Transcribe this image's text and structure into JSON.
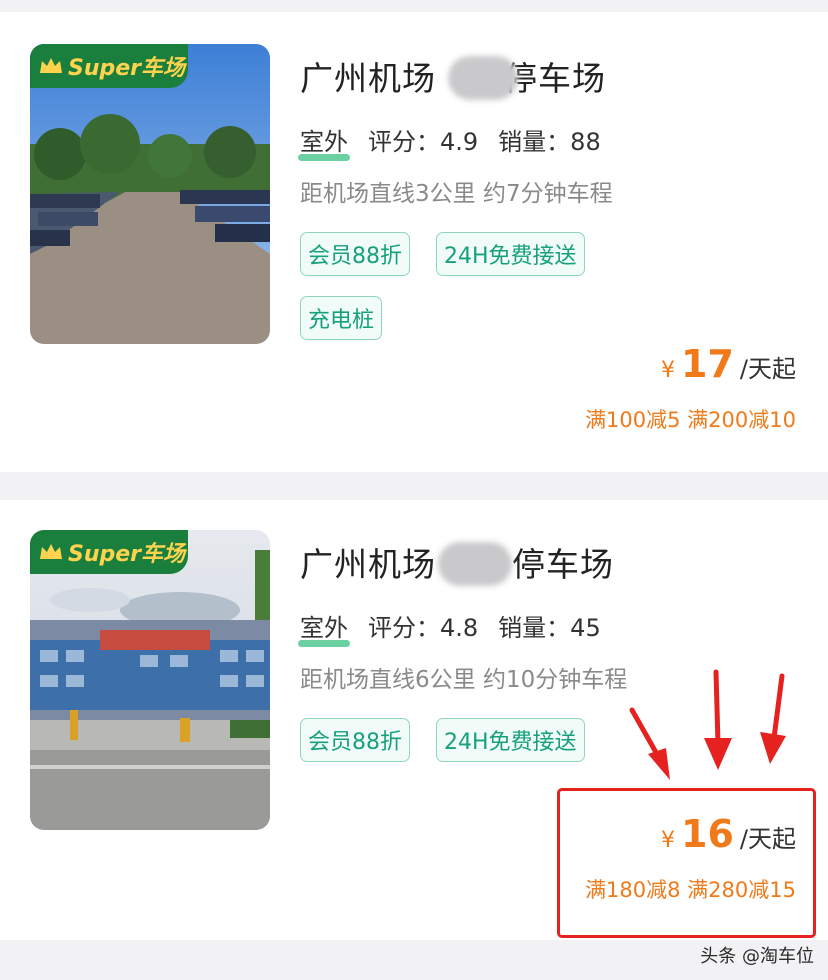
{
  "badge_label": "Super车场",
  "listings": [
    {
      "title": "广州机场",
      "title_suffix": "停车场",
      "outdoor": "室外",
      "rating_label": "评分：",
      "rating": "4.9",
      "sales_label": "销量：",
      "sales": "88",
      "distance": "距机场直线3公里 约7分钟车程",
      "tags": [
        "会员88折",
        "24H免费接送",
        "充电桩"
      ],
      "currency": "¥",
      "price": "17",
      "price_unit": "/天起",
      "promo": "满100减5 满200减10"
    },
    {
      "title": "广州机场",
      "title_suffix": "停车场",
      "outdoor": "室外",
      "rating_label": "评分：",
      "rating": "4.8",
      "sales_label": "销量：",
      "sales": "45",
      "distance": "距机场直线6公里 约10分钟车程",
      "tags": [
        "会员88折",
        "24H免费接送"
      ],
      "currency": "¥",
      "price": "16",
      "price_unit": "/天起",
      "promo": "满180减8 满280减15"
    }
  ],
  "watermark": "头条 @淘车位",
  "colors": {
    "accent_orange": "#f07a1a",
    "tag_green": "#16a07c",
    "badge_green": "#1a7f3d",
    "highlight_red": "#e5221f"
  },
  "icons": [
    "crown-icon",
    "arrow-icon"
  ]
}
